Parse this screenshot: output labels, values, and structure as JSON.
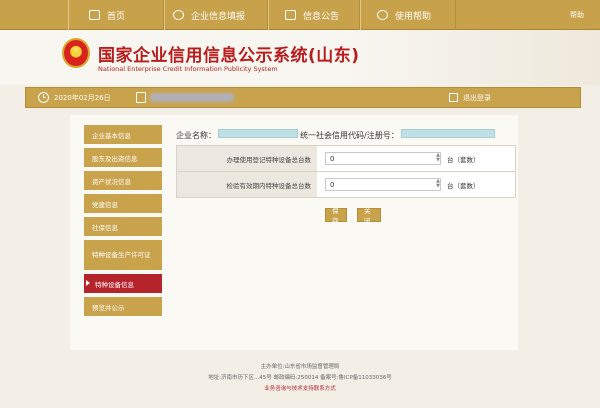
{
  "topnav": {
    "items": [
      {
        "label": "首页",
        "icon": "monitor-icon"
      },
      {
        "label": "企业信息填报",
        "icon": "gear-icon"
      },
      {
        "label": "信息公告",
        "icon": "document-icon"
      },
      {
        "label": "使用帮助",
        "icon": "help-icon"
      }
    ],
    "logout": "帮助"
  },
  "banner": {
    "title_cn": "国家企业信用信息公示系统(山东)",
    "title_en": "National Enterprise Credit Information Publicity System"
  },
  "infobar": {
    "date": "2020年02月26日",
    "exit_label": "退出登录"
  },
  "sidebar": {
    "items": [
      {
        "label": "企业基本信息"
      },
      {
        "label": "股东及出资信息"
      },
      {
        "label": "资产状况信息"
      },
      {
        "label": "党建信息"
      },
      {
        "label": "社保信息"
      },
      {
        "label": "特种设备生产许可证"
      },
      {
        "label": "特种设备信息"
      },
      {
        "label": "预览并公示"
      }
    ],
    "active_index": 6
  },
  "main": {
    "company_label": "企业名称：",
    "credit_code_label": "统一社会信用代码/注册号：",
    "rows": [
      {
        "label": "办理使用登记特种设备总台数",
        "value": "0",
        "unit": "台（套数）"
      },
      {
        "label": "检验有效期内特种设备总台数",
        "value": "0",
        "unit": "台（套数）"
      }
    ],
    "save_label": "保存",
    "close_label": "关闭"
  },
  "footer": {
    "line1": "主办单位:山东省市场监督管理局",
    "line2": "地址:济南市历下区...45号    邮政编码:250014    备案号:鲁ICP备11033036号",
    "line3": "业务咨询与技术支持联系方式"
  }
}
